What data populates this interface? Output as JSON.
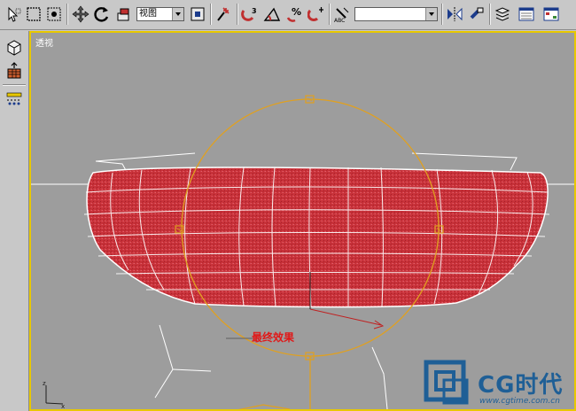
{
  "toolbar": {
    "reference_coordinate_system": "视图",
    "named_selection_set": "",
    "tools": [
      "select-object",
      "select-region",
      "select-by-name",
      "move",
      "rotate",
      "scale",
      "pivot-center",
      "select-and-manipulate",
      "snaps-toggle",
      "angle-snap",
      "percent-snap",
      "spinner-snap",
      "edit-named-selections",
      "mirror",
      "align",
      "layer-manager",
      "curve-editor",
      "schematic-view"
    ]
  },
  "command_panel": {
    "items": [
      "create-icon",
      "modify-icon",
      "hierarchy-icon",
      "motion-icon"
    ]
  },
  "viewport": {
    "label": "透视",
    "border_color": "#e8c800",
    "background": "#9d9d9d",
    "caption": "最终效果"
  },
  "scene": {
    "object_color": "#c8323a",
    "wireframe_color": "#ffffff",
    "gizmo_color": "#e0a020"
  },
  "watermark": {
    "brand": "CG时代",
    "url": "www.cgtime.com.cn",
    "color": "#1f5f96"
  }
}
